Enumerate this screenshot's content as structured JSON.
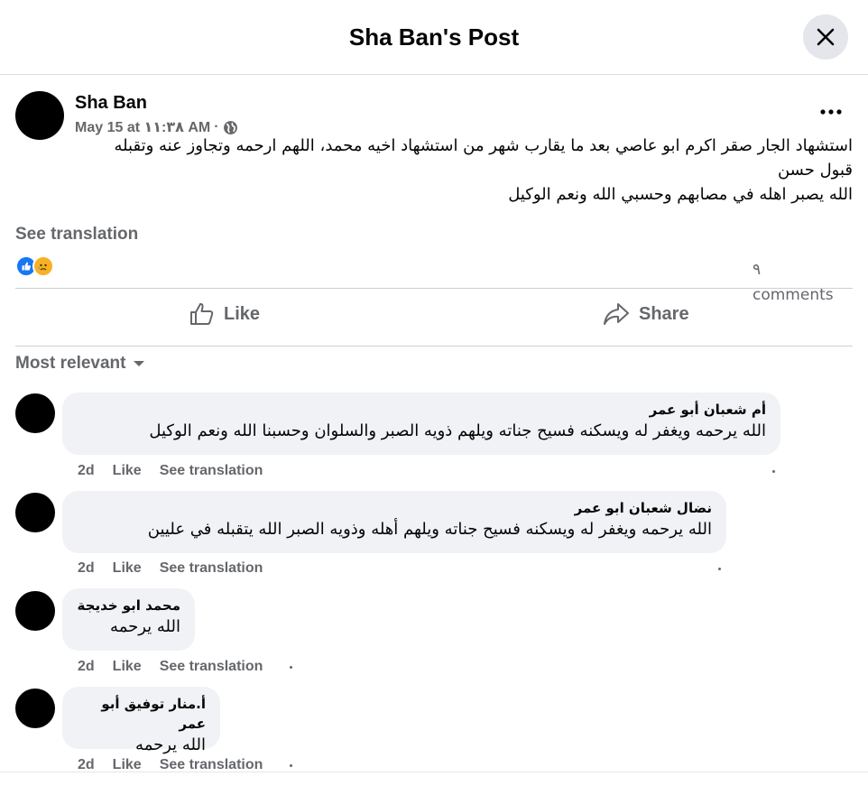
{
  "header": {
    "title": "Sha Ban's Post"
  },
  "post": {
    "author": "Sha Ban",
    "date": "May 15 at ١١:٣٨ AM",
    "separator": "·",
    "text_line1": "استشهاد الجار صقر اكرم ابو عاصي بعد ما يقارب شهر من استشهاد اخيه محمد، اللهم ارحمه وتجاوز عنه وتقبله",
    "text_line2": "قبول حسن",
    "text_line3": "الله يصبر اهله في مصابهم وحسبي الله ونعم الوكيل",
    "see_translation": "See translation",
    "reactions": [
      "like",
      "sad"
    ],
    "comment_count": "٩",
    "comment_label": "comments"
  },
  "actions": {
    "like": "Like",
    "share": "Share"
  },
  "filter": {
    "label": "Most relevant"
  },
  "comments": [
    {
      "author": "أم شعبان أبو عمر",
      "text": "الله يرحمه ويغفر له ويسكنه فسيح جناته ويلهم ذويه الصبر والسلوان وحسبنا الله ونعم الوكيل",
      "time": "2d",
      "like": "Like",
      "see_translation": "See translation"
    },
    {
      "author": "نضال شعبان ابو عمر",
      "text": "الله يرحمه ويغفر له ويسكنه فسيح جناته ويلهم أهله وذويه الصبر الله يتقبله في عليين",
      "time": "2d",
      "like": "Like",
      "see_translation": "See translation"
    },
    {
      "author": "محمد ابو خديجة",
      "text": "الله يرحمه",
      "time": "2d",
      "like": "Like",
      "see_translation": "See translation"
    },
    {
      "author": "أ.منار توفيق أبو عمر",
      "text": "الله يرحمه",
      "time": "2d",
      "like": "Like",
      "see_translation": "See translation"
    }
  ],
  "colors": {
    "accent": "#1877f2",
    "secondary_text": "#65676b",
    "bubble": "#f0f2f5"
  }
}
